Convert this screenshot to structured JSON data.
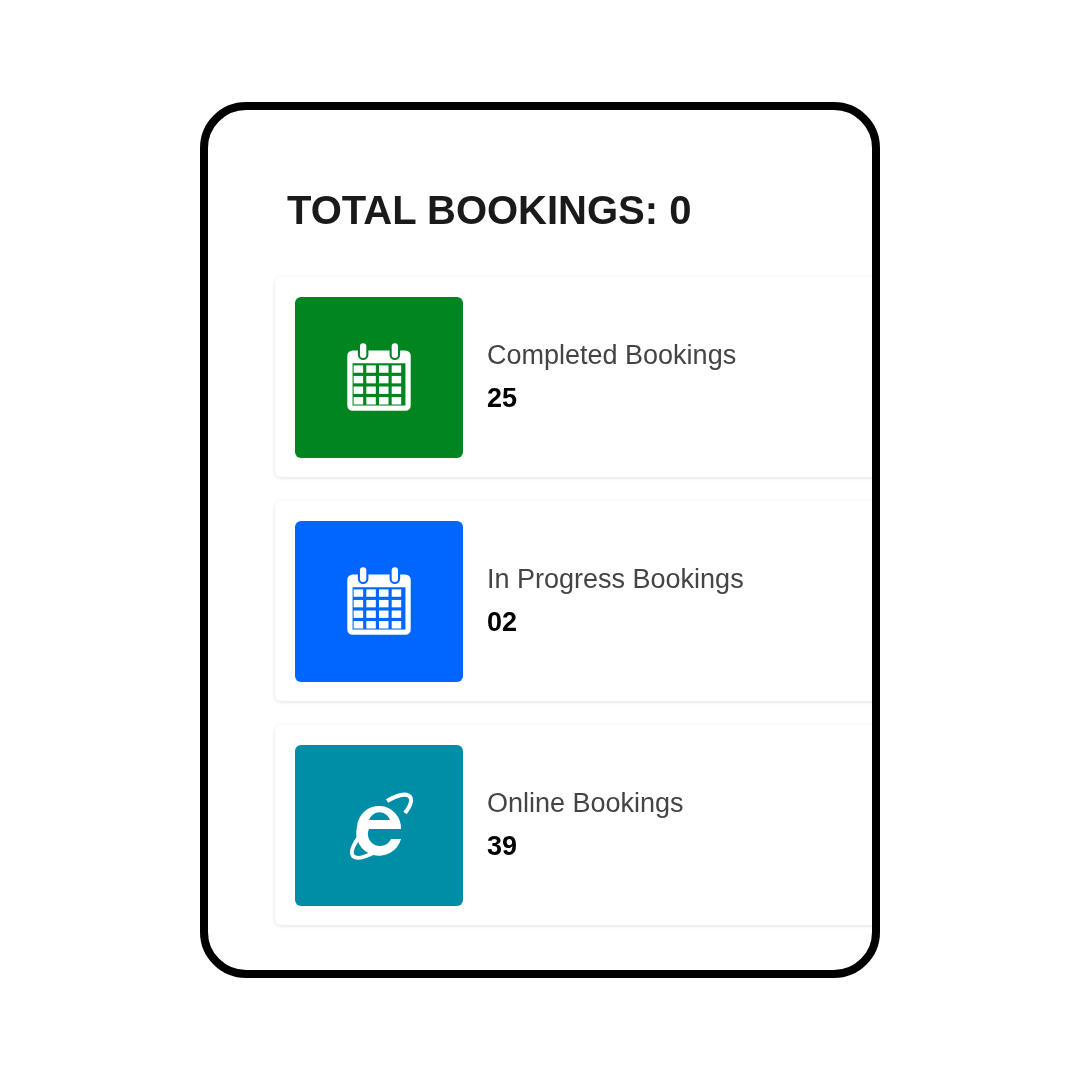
{
  "title": "TOTAL BOOKINGS: 0",
  "cards": [
    {
      "kind": "calendar",
      "color": "#008520",
      "label": "Completed Bookings",
      "value": "25"
    },
    {
      "kind": "calendar",
      "color": "#0066ff",
      "label": "In Progress Bookings",
      "value": "02"
    },
    {
      "kind": "browser",
      "color": "#008ea6",
      "label": "Online Bookings",
      "value": "39"
    }
  ]
}
